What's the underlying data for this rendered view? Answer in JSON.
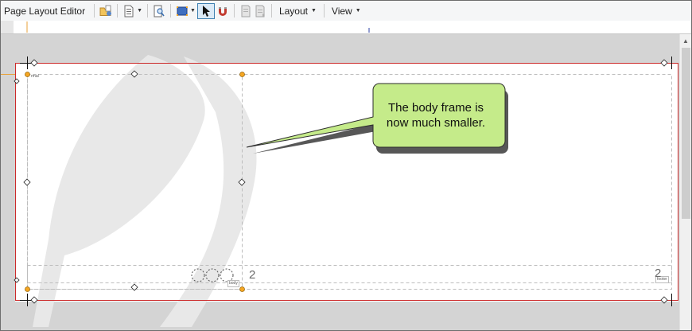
{
  "app": {
    "title": "Page Layout Editor"
  },
  "toolbar": {
    "icons": [
      "open-folder-icon",
      "page-layout-icon",
      "zoom-page-icon",
      "frame-icon",
      "select-pointer-icon",
      "magnet-icon",
      "bring-forward-icon",
      "send-backward-icon"
    ],
    "layout_menu": "Layout",
    "view_menu": "View"
  },
  "page": {
    "page_number_body": "2",
    "page_number_footer": "2",
    "frame_tag_top": "rmal",
    "frame_tag_body": "body",
    "frame_tag_footer": "footer"
  },
  "callout": {
    "text_line1": "The body frame is",
    "text_line2": "now much smaller.",
    "fill": "#c5eb8a",
    "stroke": "#2c2c2c"
  },
  "colors": {
    "page_border": "#cc2b2b",
    "handle_orange": "#f5a623",
    "canvas_bg": "#d4d4d4",
    "ruler_mark_orange": "#e8a23a",
    "ruler_mark_blue": "#2b3fa6"
  }
}
